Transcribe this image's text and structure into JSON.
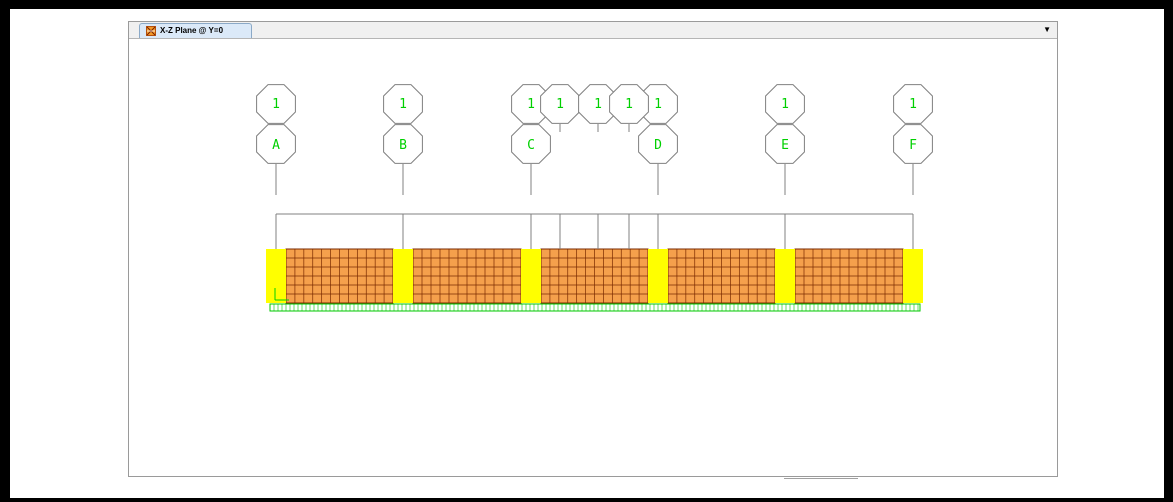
{
  "window": {
    "tab_title": "X-Z Plane @ Y=0",
    "tab_icon": "frame-view-icon",
    "tab_menu_icon": "dropdown-arrow-icon",
    "tab_menu_glyph": "▼"
  },
  "grid_bubbles": {
    "primary": [
      {
        "level": "1",
        "axis": "A"
      },
      {
        "level": "1",
        "axis": "B"
      },
      {
        "level": "1",
        "axis": "C"
      },
      {
        "level": "1",
        "axis": "D"
      },
      {
        "level": "1",
        "axis": "E"
      },
      {
        "level": "1",
        "axis": "F"
      }
    ],
    "intermediate": [
      "1",
      "1",
      "1"
    ]
  },
  "colors": {
    "bubble_line": "#808080",
    "bubble_text": "#00d000",
    "panel_fill": "#f5a04c",
    "panel_mesh": "#7a2a00",
    "support_fill": "#ffff00",
    "ground_springs": "#00c800"
  }
}
